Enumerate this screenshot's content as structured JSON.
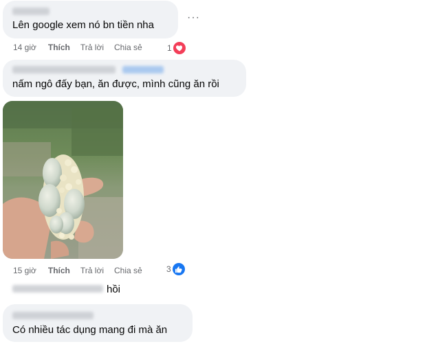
{
  "comments": [
    {
      "text": "Lên google xem nó bn tiền nha",
      "time": "14 giờ",
      "like_label": "Thích",
      "reply_label": "Trả lời",
      "share_label": "Chia sẻ",
      "reaction_count": "1",
      "reaction_icon": "heart-icon",
      "more_label": "···"
    },
    {
      "text": "nấm ngô đấy bạn, ăn được, mình cũng ăn rồi",
      "time": "15 giờ",
      "like_label": "Thích",
      "reply_label": "Trả lời",
      "share_label": "Chia sẻ",
      "reaction_count": "3",
      "reaction_icon": "like-icon"
    },
    {
      "text": "hồi"
    },
    {
      "text": "Có nhiều tác dụng mang đi mà ăn"
    }
  ],
  "colors": {
    "bubble": "#f0f2f5",
    "meta_text": "#65676b",
    "love": "#f33e58",
    "like": "#1877f2"
  }
}
